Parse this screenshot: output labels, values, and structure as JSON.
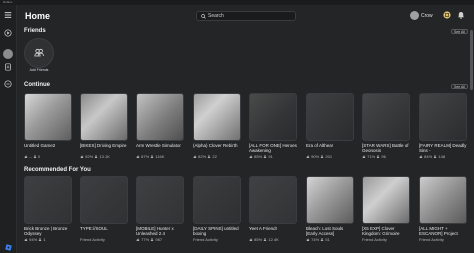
{
  "window": {
    "title": "Roblox"
  },
  "header": {
    "title": "Home",
    "search_placeholder": "Search",
    "username": "Crow"
  },
  "friends": {
    "section_title": "Friends",
    "see_all_label": "See All",
    "add_friends_label": "Add Friends"
  },
  "continue": {
    "section_title": "Continue",
    "see_all_label": "See All",
    "cards": [
      {
        "title": "Untitled Game2",
        "rating": "--",
        "players": "0"
      },
      {
        "title": "[BIKES] Driving Empire",
        "rating": "92%",
        "players": "13.1K"
      },
      {
        "title": "Arm Wrestle Simulator",
        "rating": "87%",
        "players": "116K"
      },
      {
        "title": "(Alpha) Clover Rebirth",
        "rating": "82%",
        "players": "22"
      },
      {
        "title": "[ALL FOR ONE] Heroes Awakening",
        "rating": "85%",
        "players": "91"
      },
      {
        "title": "Era of Althea!",
        "rating": "90%",
        "players": "201"
      },
      {
        "title": "[STAR WARS] Battle of Geonosis",
        "rating": "71%",
        "players": "96"
      },
      {
        "title": "[FAIRY REALM] Deadly Sins -",
        "rating": "84%",
        "players": "148"
      }
    ]
  },
  "recommended": {
    "section_title": "Recommended For You",
    "cards": [
      {
        "title": "Brick Bronze | Bronze Odyssey",
        "rating": "94%",
        "players": "1"
      },
      {
        "title": "TYPE://SOUL",
        "subtitle": "Friend Activity"
      },
      {
        "title": "[MOBILE] Hunter x Unleashed 2.4",
        "rating": "77%",
        "players": "987"
      },
      {
        "title": "[DAILY SPINS] untitled boxing",
        "subtitle": "Friend Activity"
      },
      {
        "title": "Yeet A Friend!",
        "rating": "85%",
        "players": "12.4K"
      },
      {
        "title": "Bleach: Lost Souls [Early Access]",
        "rating": "74%",
        "players": "51"
      },
      {
        "title": "[X5 EXP] Clover Kingdom: Grimoire",
        "subtitle": "Friend Activity"
      },
      {
        "title": "[ALL MIGHT + ESCANOR] Project",
        "subtitle": "Friend Activity"
      }
    ]
  }
}
